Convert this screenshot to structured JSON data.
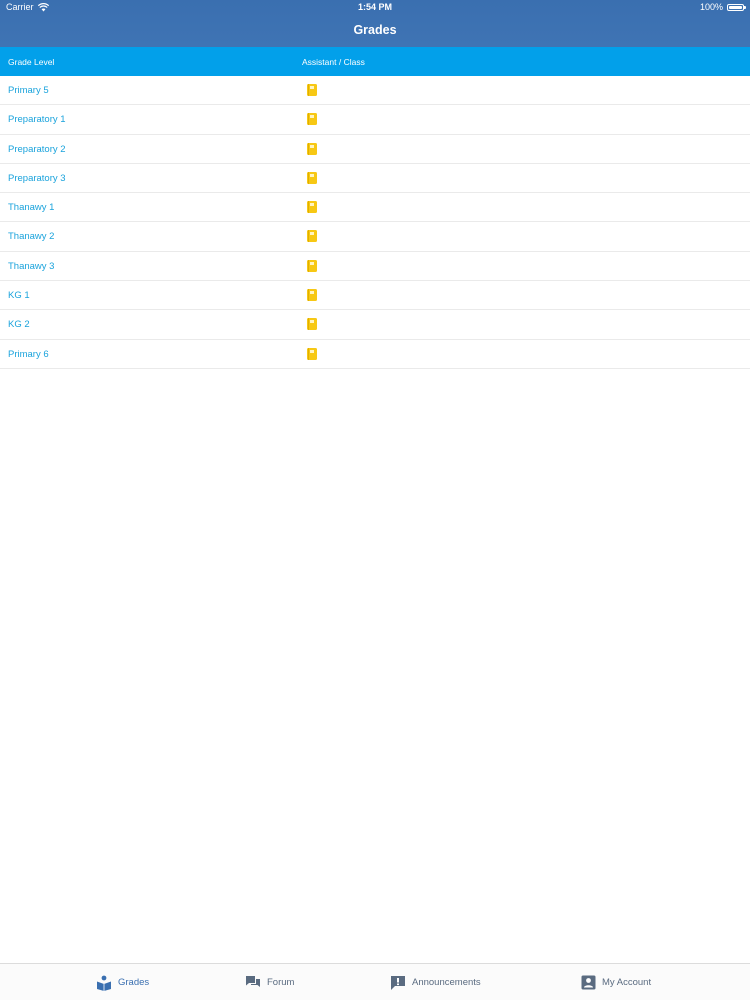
{
  "status_bar": {
    "carrier": "Carrier",
    "time": "1:54 PM",
    "battery": "100%"
  },
  "nav": {
    "title": "Grades"
  },
  "table": {
    "headers": {
      "grade_level": "Grade Level",
      "assistant_class": "Assistant / Class"
    },
    "rows": [
      {
        "label": "Primary 5",
        "icon": "book-icon"
      },
      {
        "label": "Preparatory 1",
        "icon": "book-icon"
      },
      {
        "label": "Preparatory 2",
        "icon": "book-icon"
      },
      {
        "label": "Preparatory 3",
        "icon": "book-icon"
      },
      {
        "label": "Thanawy 1",
        "icon": "book-icon"
      },
      {
        "label": "Thanawy 2",
        "icon": "book-icon"
      },
      {
        "label": "Thanawy 3",
        "icon": "book-icon"
      },
      {
        "label": "KG 1",
        "icon": "book-icon"
      },
      {
        "label": "KG 2",
        "icon": "book-icon"
      },
      {
        "label": "Primary 6",
        "icon": "book-icon"
      }
    ]
  },
  "tabbar": {
    "tabs": [
      {
        "label": "Grades",
        "icon": "reader-book-icon",
        "active": true
      },
      {
        "label": "Forum",
        "icon": "chat-bubbles-icon",
        "active": false
      },
      {
        "label": "Announcements",
        "icon": "exclamation-bubble-icon",
        "active": false
      },
      {
        "label": "My Account",
        "icon": "user-card-icon",
        "active": false
      }
    ]
  },
  "colors": {
    "nav_bar": "#3a6fb0",
    "header_row": "#02a0ea",
    "row_text": "#1aa3dc",
    "book_icon": "#f7c814",
    "tab_active": "#3a6fb0",
    "tab_inactive": "#5a6b80"
  }
}
